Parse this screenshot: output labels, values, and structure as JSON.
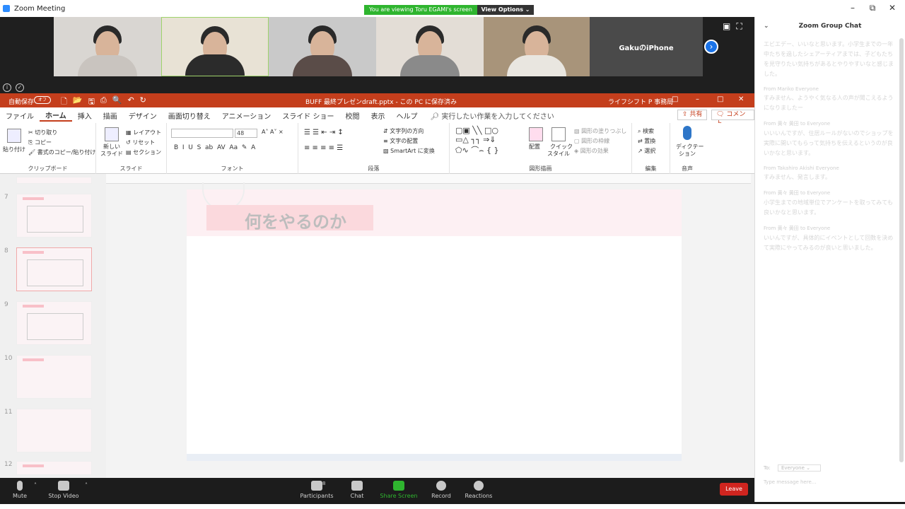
{
  "window": {
    "title": "Zoom Meeting"
  },
  "share_banner": {
    "text": "You are viewing Toru EGAMI's screen",
    "view_options": "View Options"
  },
  "video": {
    "last_tile_name": "GakuのiPhone"
  },
  "ppt": {
    "autosave_label": "自動保存",
    "autosave_state": "オフ",
    "doc_title": "BUFF 最終プレゼンdraft.pptx - この PC に保存済み",
    "user": "ライフシフト P 事務局",
    "tabs": [
      "ファイル",
      "ホーム",
      "挿入",
      "描画",
      "デザイン",
      "画面切り替え",
      "アニメーション",
      "スライド ショー",
      "校閲",
      "表示",
      "ヘルプ"
    ],
    "tell_me": "実行したい作業を入力してください",
    "share_btn": "共有",
    "comment_btn": "コメント",
    "ribbon": {
      "paste": "貼り付け",
      "cut": "切り取り",
      "copy": "コピー",
      "format_painter": "書式のコピー/貼り付け",
      "clipboard": "クリップボード",
      "new_slide": "新しい",
      "new_slide2": "スライド",
      "layout": "レイアウト",
      "reset": "リセット",
      "section": "セクション",
      "slides": "スライド",
      "font_size": "48",
      "font": "フォント",
      "text_direction": "文字列の方向",
      "align_text": "文字の配置",
      "smartart": "SmartArt に変換",
      "paragraph": "段落",
      "arrange": "配置",
      "quick_styles": "クイック",
      "quick_styles2": "スタイル",
      "shape_fill": "図形の塗りつぶし",
      "shape_outline": "図形の枠線",
      "shape_effects": "図形の効果",
      "drawing": "図形描画",
      "find": "検索",
      "replace": "置換",
      "select": "選択",
      "editing": "編集",
      "dictate": "ディクテー",
      "dictate2": "ション",
      "voice": "音声"
    },
    "slide_numbers": [
      "7",
      "8",
      "9",
      "10",
      "11",
      "12"
    ],
    "slide_title": "何をやるのか"
  },
  "chat": {
    "title": "Zoom Group Chat",
    "messages": [
      {
        "from": "",
        "text": "エビエデー、いいなと思います。小学生までの一年中たちを過したシェアーティアまでは、子どもたちを見守りたい気持ちがあるとやりやすいなと感じました。"
      },
      {
        "from": "From Mariko Everyone",
        "text": "すみません、ようやく気なる人の声が聞こえるようになりましたー"
      },
      {
        "from": "From 黄々 黄田 to Everyone",
        "text": "いいいんですが、住居ルールがないのでショップを実際に開いてもらって気持ちを伝えるというのが良いかなと思います。"
      },
      {
        "from": "From Takahiro Akishi Everyone",
        "text": "すみません、発言します。"
      },
      {
        "from": "From 黄々 黄田 to Everyone",
        "text": "小学生までの地域単位でアンケートを取ってみても良いかなと思います。"
      },
      {
        "from": "From 黄々 黄田 to Everyone",
        "text": "いいんですが、具体的にイベントとして回数を決めて実際にやってみるのが良いと思いました。"
      }
    ],
    "to_label": "To:",
    "to_value": "Everyone",
    "type_placeholder": "Type message here..."
  },
  "toolbar": {
    "mute": "Mute",
    "stop_video": "Stop Video",
    "participants": "Participants",
    "participants_count": "8",
    "chat": "Chat",
    "share_screen": "Share Screen",
    "record": "Record",
    "reactions": "Reactions",
    "leave": "Leave"
  },
  "colors": {
    "ppt_accent": "#c43e1c",
    "zoom_share": "#2fb52f",
    "leave": "#d0251f"
  }
}
